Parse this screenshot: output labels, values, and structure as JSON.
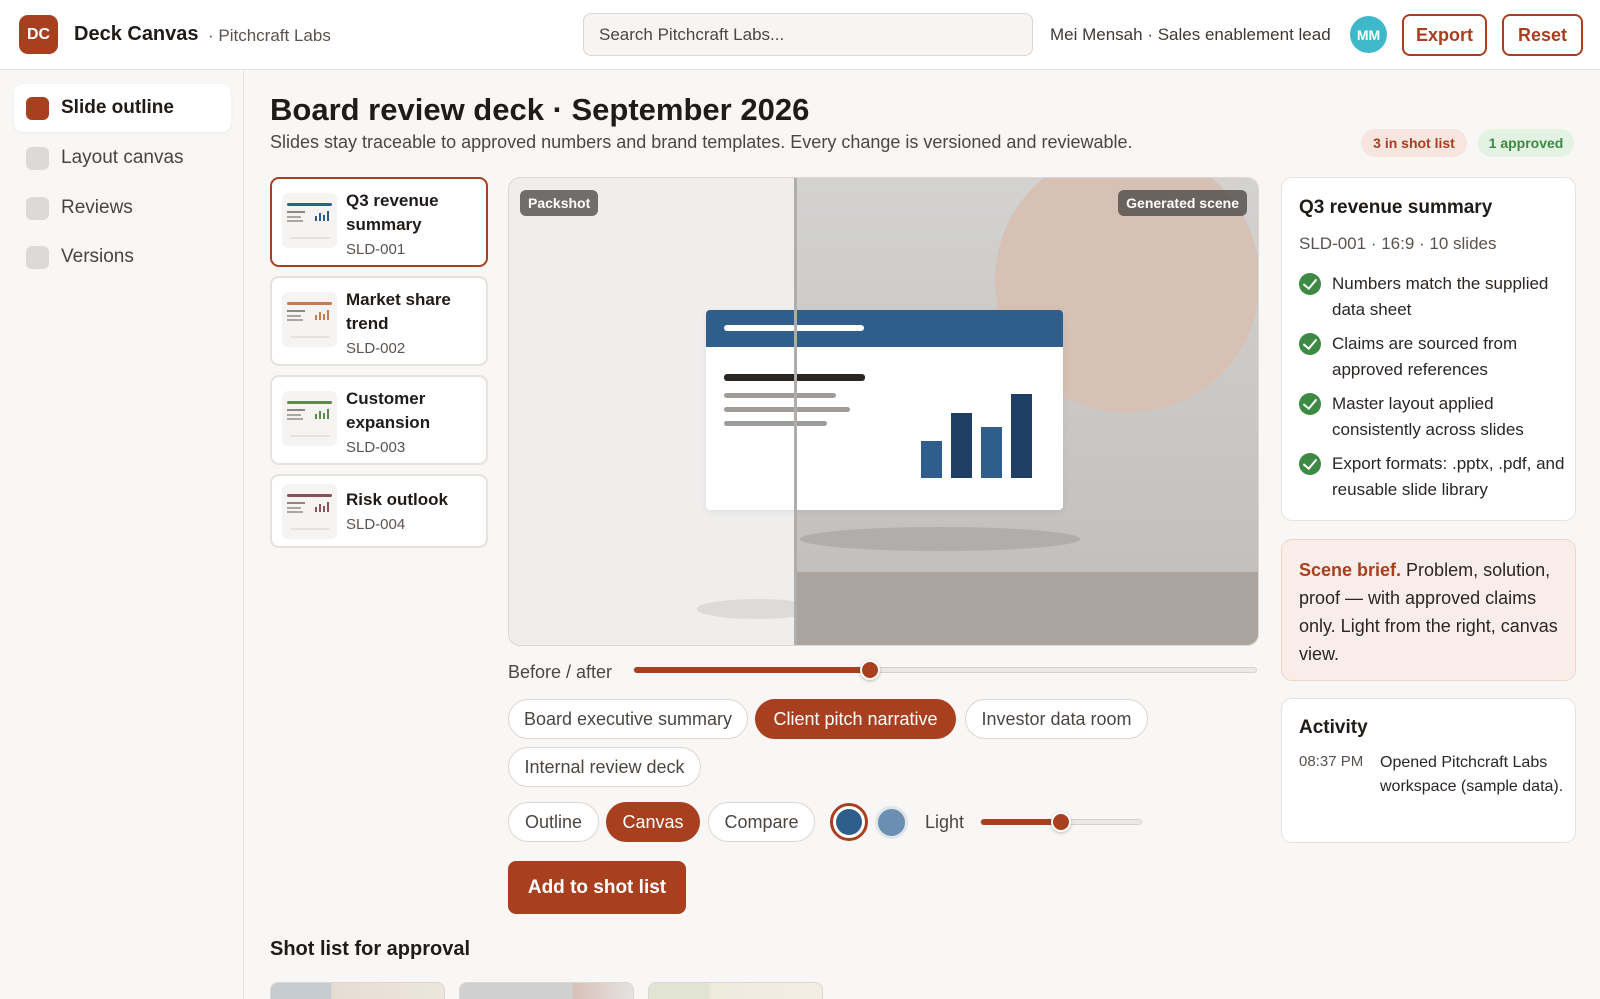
{
  "app": {
    "logo": "DC",
    "title": "Deck Canvas",
    "workspace": "· Pitchcraft Labs",
    "search_placeholder": "Search Pitchcraft Labs...",
    "user": "Mei Mensah · Sales enablement lead",
    "avatar": "MM",
    "export_label": "Export",
    "reset_label": "Reset"
  },
  "colors": {
    "accent": "#a8401f",
    "success": "#3c8a43",
    "avatar": "#3fb8c9",
    "slide_header": "#2f5d8c"
  },
  "sidebar": {
    "items": [
      {
        "label": "Slide outline",
        "active": true
      },
      {
        "label": "Layout canvas",
        "active": false
      },
      {
        "label": "Reviews",
        "active": false
      },
      {
        "label": "Versions",
        "active": false
      }
    ]
  },
  "header": {
    "title": "Board review deck · September 2026",
    "subtitle": "Slides stay traceable to approved numbers and brand templates. Every change is versioned and reviewable.",
    "badge_shot_list": "3 in shot list",
    "badge_approved": "1 approved"
  },
  "slides": [
    {
      "title": "Q3 revenue summary",
      "id": "SLD-001",
      "accent": "#2f5d8c",
      "selected": true
    },
    {
      "title": "Market share trend",
      "id": "SLD-002",
      "accent": "#c47a4a",
      "selected": false
    },
    {
      "title": "Customer expansion",
      "id": "SLD-003",
      "accent": "#5e8a4e",
      "selected": false
    },
    {
      "title": "Risk outlook",
      "id": "SLD-004",
      "accent": "#8a4e5e",
      "selected": false
    }
  ],
  "canvas": {
    "tag_before": "Packshot",
    "tag_after": "Generated scene",
    "before_after_label": "Before / after",
    "before_after_value": 0.38
  },
  "narratives": {
    "options": [
      "Board executive summary",
      "Client pitch narrative",
      "Investor data room",
      "Internal review deck"
    ],
    "selected": "Client pitch narrative"
  },
  "view_modes": {
    "options": [
      "Outline",
      "Canvas",
      "Compare"
    ],
    "selected": "Canvas"
  },
  "swatches": [
    {
      "color": "#2f5d8c",
      "name": "blue-swatch",
      "selected": true
    },
    {
      "color": "#6a8fb3",
      "name": "light-blue-swatch",
      "selected": false
    }
  ],
  "light": {
    "label": "Light",
    "value": 0.5
  },
  "actions": {
    "add_to_shot_list": "Add to shot list"
  },
  "shot_list": {
    "title": "Shot list for approval"
  },
  "details": {
    "title": "Q3 revenue summary",
    "meta": "SLD-001 · 16:9 · 10 slides",
    "checks": [
      "Numbers match the supplied data sheet",
      "Claims are sourced from approved references",
      "Master layout applied consistently across slides",
      "Export formats: .pptx, .pdf, and reusable slide library"
    ]
  },
  "brief": {
    "label": "Scene brief.",
    "text": " Problem, solution, proof — with approved claims only. Light from the right, canvas view."
  },
  "activity": {
    "title": "Activity",
    "entries": [
      {
        "time": "08:37 PM",
        "text": "Opened Pitchcraft Labs workspace (sample data)."
      }
    ]
  }
}
